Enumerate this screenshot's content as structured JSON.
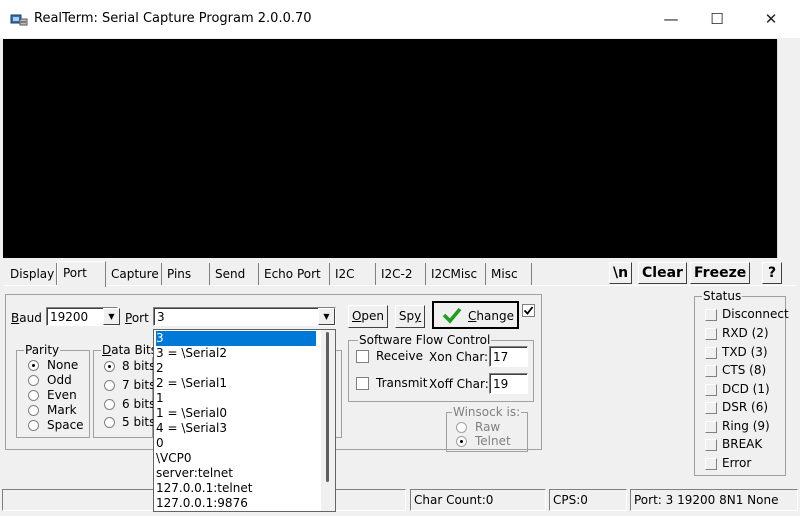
{
  "window": {
    "title": "RealTerm: Serial Capture Program 2.0.0.70",
    "minimize": "—",
    "maximize": "☐",
    "close": "✕"
  },
  "tabs": [
    "Display",
    "Port",
    "Capture",
    "Pins",
    "Send",
    "Echo Port",
    "I2C",
    "I2C-2",
    "I2CMisc",
    "Misc"
  ],
  "active_tab": "Port",
  "right_buttons": {
    "newline": "\\n",
    "clear": "Clear",
    "freeze": "Freeze",
    "help": "?"
  },
  "port_panel": {
    "baud_label_u": "B",
    "baud_label_rest": "aud",
    "baud_value": "19200",
    "port_label_u": "P",
    "port_label_rest": "ort",
    "port_value": "3",
    "open_u": "O",
    "open_rest": "pen",
    "spy_pre": "Sp",
    "spy_u": "y",
    "change_pre": "",
    "change_u": "C",
    "change_rest": "hange",
    "change_checked": true,
    "parity": {
      "title": "Parity",
      "options": [
        "None",
        "Odd",
        "Even",
        "Mark",
        "Space"
      ],
      "selected": "None"
    },
    "data_bits": {
      "title_u": "D",
      "title_rest": "ata Bits",
      "options": [
        "8 bits",
        "7 bits",
        "6 bits",
        "5 bits"
      ],
      "selected": "8 bits"
    },
    "sw_flow": {
      "title": "Software Flow Control",
      "receive": "Receive",
      "transmit": "Transmit",
      "xon_label": "Xon Char:",
      "xon_value": "17",
      "xoff_label": "Xoff Char:",
      "xoff_value": "19"
    },
    "winsock": {
      "title": "Winsock is:",
      "options": [
        "Raw",
        "Telnet"
      ],
      "selected": "Telnet"
    }
  },
  "port_dropdown": {
    "items": [
      "3",
      "3 = \\Serial2",
      "2",
      "2 = \\Serial1",
      "1",
      "1 = \\Serial0",
      "4 = \\Serial3",
      "0",
      "\\VCP0",
      "server:telnet",
      "127.0.0.1:telnet",
      "127.0.0.1:9876"
    ],
    "selected_index": 0
  },
  "status": {
    "title": "Status",
    "items": [
      "Disconnect",
      "RXD (2)",
      "TXD (3)",
      "CTS (8)",
      "DCD (1)",
      "DSR (6)",
      "Ring (9)",
      "BREAK",
      "Error"
    ]
  },
  "statusbar": {
    "char_count": "Char Count:0",
    "cps": "CPS:0",
    "port_info": "Port: 3 19200 8N1 None"
  },
  "colors": {
    "selection": "#0078d7",
    "terminal_bg": "#000000",
    "check_green": "#1e9e1e"
  }
}
